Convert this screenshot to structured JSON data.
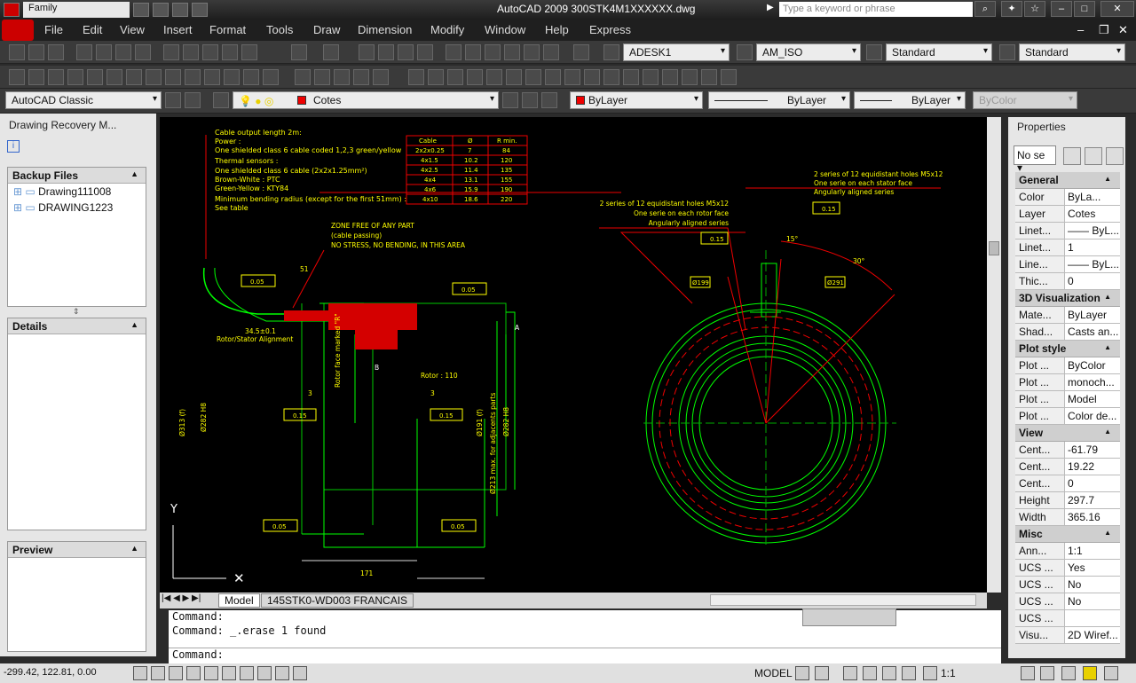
{
  "window": {
    "workspace_name": "Family",
    "title": "AutoCAD 2009  300STK4M1XXXXXX.dwg",
    "search_placeholder": "Type a keyword or phrase"
  },
  "menu": [
    "File",
    "Edit",
    "View",
    "Insert",
    "Format",
    "Tools",
    "Draw",
    "Dimension",
    "Modify",
    "Window",
    "Help",
    "Express"
  ],
  "toolbar": {
    "text_style": "ADESK1",
    "dim_style": "AM_ISO",
    "table_style": "Standard",
    "mleader_style": "Standard",
    "workspace": "AutoCAD Classic",
    "layer": "Cotes",
    "color": "ByLayer",
    "linetype": "ByLayer",
    "lineweight": "ByLayer",
    "plotstyle": "ByColor"
  },
  "left_panel": {
    "title": "Drawing Recovery M...",
    "backup_header": "Backup Files",
    "backup_items": [
      "Drawing111008",
      "DRAWING1223"
    ],
    "details_header": "Details",
    "preview_header": "Preview"
  },
  "tabs": {
    "model": "Model",
    "layout": "145STK0-WD003 FRANCAIS"
  },
  "command": {
    "lines": [
      "Command:",
      "Command:  _.erase 1 found"
    ],
    "prompt": "Command:"
  },
  "properties": {
    "title": "Properties",
    "selection": "No se",
    "groups": [
      {
        "name": "General",
        "rows": [
          [
            "Color",
            "ByLa..."
          ],
          [
            "Layer",
            "Cotes"
          ],
          [
            "Linet...",
            "—— ByL..."
          ],
          [
            "Linet...",
            "1"
          ],
          [
            "Line...",
            "—— ByL..."
          ],
          [
            "Thic...",
            "0"
          ]
        ]
      },
      {
        "name": "3D Visualization",
        "rows": [
          [
            "Mate...",
            "ByLayer"
          ],
          [
            "Shad...",
            "Casts an..."
          ]
        ]
      },
      {
        "name": "Plot style",
        "rows": [
          [
            "Plot ...",
            "ByColor"
          ],
          [
            "Plot ...",
            "monoch..."
          ],
          [
            "Plot ...",
            "Model"
          ],
          [
            "Plot ...",
            "Color de..."
          ]
        ]
      },
      {
        "name": "View",
        "rows": [
          [
            "Cent...",
            "-61.79"
          ],
          [
            "Cent...",
            "19.22"
          ],
          [
            "Cent...",
            "0"
          ],
          [
            "Height",
            "297.7"
          ],
          [
            "Width",
            "365.16"
          ]
        ]
      },
      {
        "name": "Misc",
        "rows": [
          [
            "Ann...",
            "1:1"
          ],
          [
            "UCS ...",
            "Yes"
          ],
          [
            "UCS ...",
            "No"
          ],
          [
            "UCS ...",
            "No"
          ],
          [
            "UCS ...",
            ""
          ],
          [
            "Visu...",
            "2D Wiref..."
          ]
        ]
      }
    ]
  },
  "status": {
    "coords": "-299.42, 122.81, 0.00",
    "space": "MODEL",
    "scale": "1:1"
  },
  "drawing": {
    "notes": [
      "Cable output length  2m:",
      "Power :",
      "One shielded class 6 cable coded 1,2,3 green/yellow",
      "Thermal sensors :",
      "One shielded class 6 cable (2x2x1.25mm²)",
      "Brown-White : PTC",
      "Green-Yellow : KTY84",
      "Minimum bending radius (except for the first 51mm) :",
      "See table"
    ],
    "table_head": [
      "Cable",
      "Ø",
      "R min."
    ],
    "table_rows": [
      [
        "2x2x0.25",
        "7",
        "84"
      ],
      [
        "4x1.5",
        "10.2",
        "120"
      ],
      [
        "4x2.5",
        "11.4",
        "135"
      ],
      [
        "4x4",
        "13.1",
        "155"
      ],
      [
        "4x6",
        "15.9",
        "190"
      ],
      [
        "4x10",
        "18.6",
        "220"
      ]
    ],
    "zone_note": [
      "ZONE FREE OF ANY PART",
      "(cable passing)",
      "NO STRESS, NO BENDING, IN THIS AREA"
    ],
    "holes_left": [
      "2 series of 12 equidistant holes M5x12",
      "One serie on each rotor face",
      "Angularly aligned series"
    ],
    "holes_right": [
      "2 series of 12 equidistant holes M5x12",
      "One serie on each stator face",
      "Angularly aligned series"
    ],
    "dims": {
      "d51": "51",
      "alignment": "34.5±0.1",
      "alignment_label": "Rotor/Stator Alignment",
      "rotor_face": "Rotor face marked \"R\"",
      "rotor": "Rotor : 110",
      "d3a": "3",
      "d3b": "3",
      "d313": "Ø313 (f)",
      "d282": "Ø282 H8",
      "d191": "Ø191 (f)",
      "d282b": "Ø282 H8",
      "d213": "Ø213 max. for adjacents parts",
      "d171": "171",
      "a15": "15°",
      "a30": "30°",
      "d199": "Ø199",
      "d291": "Ø291",
      "tolA": "0.05",
      "tolB": "0.15",
      "datumA": "A",
      "datumB": "B",
      "tol_holes": "0.15"
    }
  }
}
